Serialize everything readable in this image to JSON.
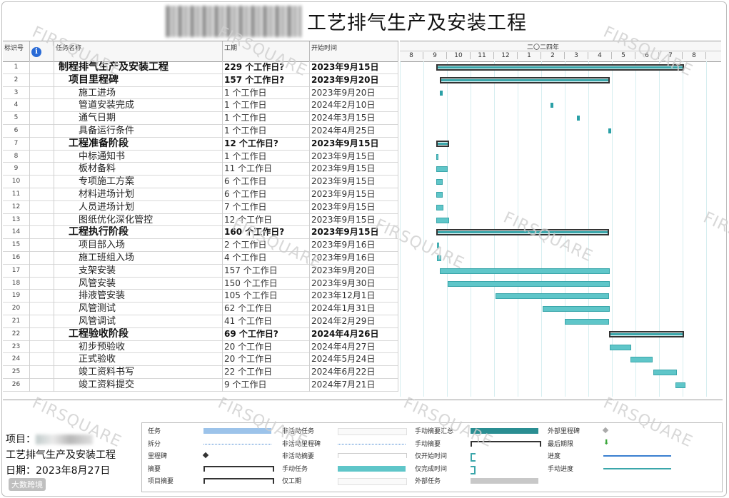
{
  "title": "工艺排气生产及安装工程",
  "columns": {
    "id": "标识号",
    "name": "任务名称",
    "duration": "工期",
    "start": "开始时间"
  },
  "timeline": {
    "year_label": "二〇二四年",
    "months": [
      "8",
      "9",
      "10",
      "11",
      "12",
      "1",
      "2",
      "3",
      "4",
      "5",
      "6",
      "7",
      "8"
    ]
  },
  "tasks": [
    {
      "id": "1",
      "name": "制程排气生产及安装工程",
      "duration": "229 个工作日?",
      "start": "2023年9月15日",
      "summary": true
    },
    {
      "id": "2",
      "name": "项目里程碑",
      "duration": "157 个工作日?",
      "start": "2023年9月20日",
      "summary": true
    },
    {
      "id": "3",
      "name": "施工进场",
      "duration": "1 个工作日",
      "start": "2023年9月20日"
    },
    {
      "id": "4",
      "name": "管道安装完成",
      "duration": "1 个工作日",
      "start": "2024年2月10日"
    },
    {
      "id": "5",
      "name": "通气日期",
      "duration": "1 个工作日",
      "start": "2024年3月15日"
    },
    {
      "id": "6",
      "name": "具备运行条件",
      "duration": "1 个工作日",
      "start": "2024年4月25日"
    },
    {
      "id": "7",
      "name": "工程准备阶段",
      "duration": "12 个工作日?",
      "start": "2023年9月15日",
      "summary": true
    },
    {
      "id": "8",
      "name": "中标通知书",
      "duration": "1 个工作日",
      "start": "2023年9月15日"
    },
    {
      "id": "9",
      "name": "板材备料",
      "duration": "11 个工作日",
      "start": "2023年9月15日"
    },
    {
      "id": "10",
      "name": "专项施工方案",
      "duration": "6 个工作日",
      "start": "2023年9月15日"
    },
    {
      "id": "11",
      "name": "材料进场计划",
      "duration": "6 个工作日",
      "start": "2023年9月15日"
    },
    {
      "id": "12",
      "name": "人员进场计划",
      "duration": "7 个工作日",
      "start": "2023年9月15日"
    },
    {
      "id": "13",
      "name": "图纸优化深化管控",
      "duration": "12 个工作日",
      "start": "2023年9月15日"
    },
    {
      "id": "14",
      "name": "工程执行阶段",
      "duration": "160 个工作日?",
      "start": "2023年9月15日",
      "summary": true
    },
    {
      "id": "15",
      "name": "项目部入场",
      "duration": "2 个工作日",
      "start": "2023年9月16日"
    },
    {
      "id": "16",
      "name": "施工班组入场",
      "duration": "4 个工作日",
      "start": "2023年9月16日"
    },
    {
      "id": "17",
      "name": "支架安装",
      "duration": "157 个工作日",
      "start": "2023年9月20日"
    },
    {
      "id": "18",
      "name": "风管安装",
      "duration": "150 个工作日",
      "start": "2023年9月30日"
    },
    {
      "id": "19",
      "name": "排液管安装",
      "duration": "105 个工作日",
      "start": "2023年12月1日"
    },
    {
      "id": "20",
      "name": "风管测试",
      "duration": "62 个工作日",
      "start": "2024年1月31日"
    },
    {
      "id": "21",
      "name": "风管调试",
      "duration": "41 个工作日",
      "start": "2024年2月29日"
    },
    {
      "id": "22",
      "name": "工程验收阶段",
      "duration": "69 个工作日?",
      "start": "2024年4月26日",
      "summary": true
    },
    {
      "id": "23",
      "name": "初步预验收",
      "duration": "20 个工作日",
      "start": "2024年4月27日"
    },
    {
      "id": "24",
      "name": "正式验收",
      "duration": "20 个工作日",
      "start": "2024年5月24日"
    },
    {
      "id": "25",
      "name": "竣工资料书写",
      "duration": "22 个工作日",
      "start": "2024年6月22日"
    },
    {
      "id": "26",
      "name": "竣工资料提交",
      "duration": "9 个工作日",
      "start": "2024年7月21日"
    }
  ],
  "project": {
    "label": "项目：",
    "name_line": "工艺排气生产及安装工程",
    "date_label": "日期：",
    "date": "2023年8月27日"
  },
  "legend": [
    [
      "任务",
      "拆分",
      "里程碑",
      "摘要",
      "项目摘要"
    ],
    [
      "非活动任务",
      "非活动里程碑",
      "非活动摘要",
      "手动任务",
      "仅工期"
    ],
    [
      "手动摘要汇总",
      "手动摘要",
      "仅开始时间",
      "仅完成时间",
      "外部任务"
    ],
    [
      "外部里程碑",
      "最后期限",
      "进度",
      "手动进度"
    ]
  ],
  "watermark": "FIRSQUARE",
  "footer_mark": "大数跨境",
  "colors": {
    "bar": "#5fc6c9",
    "bar_border": "#3aa6aa",
    "summary": "#333333"
  }
}
